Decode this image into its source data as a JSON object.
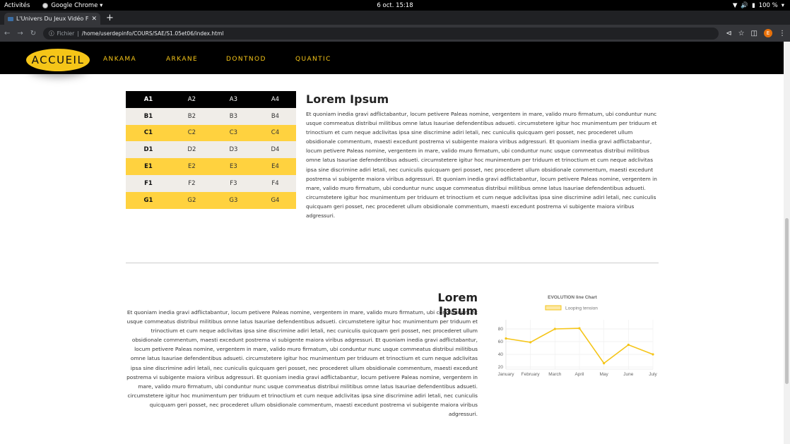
{
  "system_bar": {
    "activities": "Activités",
    "app_name": "Google Chrome ▾",
    "clock": "6 oct.  15:18",
    "battery": "100 %"
  },
  "browser": {
    "tab_title": "L'Univers Du Jeux Vidéo F",
    "address_label": "Fichier",
    "address_path": "/home/userdepinfo/COURS/SAE/S1.05et06/index.html",
    "profile_initial": "E"
  },
  "nav": {
    "home": "ACCUEIL",
    "links": [
      "ANKAMA",
      "ARKANE",
      "DONTNOD",
      "QUANTIC"
    ]
  },
  "table": {
    "rows": [
      [
        "A1",
        "A2",
        "A3",
        "A4"
      ],
      [
        "B1",
        "B2",
        "B3",
        "B4"
      ],
      [
        "C1",
        "C2",
        "C3",
        "C4"
      ],
      [
        "D1",
        "D2",
        "D3",
        "D4"
      ],
      [
        "E1",
        "E2",
        "E3",
        "E4"
      ],
      [
        "F1",
        "F2",
        "F3",
        "F4"
      ],
      [
        "G1",
        "G2",
        "G3",
        "G4"
      ]
    ]
  },
  "section1": {
    "heading": "Lorem Ipsum",
    "body": "Et quoniam inedia gravi adflictabantur, locum petivere Paleas nomine, vergentem in mare, valido muro firmatum, ubi conduntur nunc usque commeatus distribui militibus omne latus Isauriae defendentibus adsueti. circumstetere igitur hoc munimentum per triduum et trinoctium et cum neque adclivitas ipsa sine discrimine adiri letali, nec cuniculis quicquam geri posset, nec procederet ullum obsidionale commentum, maesti excedunt postrema vi subigente maiora viribus adgressuri. Et quoniam inedia gravi adflictabantur, locum petivere Paleas nomine, vergentem in mare, valido muro firmatum, ubi conduntur nunc usque commeatus distribui militibus omne latus Isauriae defendentibus adsueti. circumstetere igitur hoc munimentum per triduum et trinoctium et cum neque adclivitas ipsa sine discrimine adiri letali, nec cuniculis quicquam geri posset, nec procederet ullum obsidionale commentum, maesti excedunt postrema vi subigente maiora viribus adgressuri. Et quoniam inedia gravi adflictabantur, locum petivere Paleas nomine, vergentem in mare, valido muro firmatum, ubi conduntur nunc usque commeatus distribui militibus omne latus Isauriae defendentibus adsueti. circumstetere igitur hoc munimentum per triduum et trinoctium et cum neque adclivitas ipsa sine discrimine adiri letali, nec cuniculis quicquam geri posset, nec procederet ullum obsidionale commentum, maesti excedunt postrema vi subigente maiora viribus adgressuri."
  },
  "section2": {
    "heading": "Lorem Ipsum",
    "body": "Et quoniam inedia gravi adflictabantur, locum petivere Paleas nomine, vergentem in mare, valido muro firmatum, ubi conduntur nunc usque commeatus distribui militibus omne latus Isauriae defendentibus adsueti. circumstetere igitur hoc munimentum per triduum et trinoctium et cum neque adclivitas ipsa sine discrimine adiri letali, nec cuniculis quicquam geri posset, nec procederet ullum obsidionale commentum, maesti excedunt postrema vi subigente maiora viribus adgressuri. Et quoniam inedia gravi adflictabantur, locum petivere Paleas nomine, vergentem in mare, valido muro firmatum, ubi conduntur nunc usque commeatus distribui militibus omne latus Isauriae defendentibus adsueti. circumstetere igitur hoc munimentum per triduum et trinoctium et cum neque adclivitas ipsa sine discrimine adiri letali, nec cuniculis quicquam geri posset, nec procederet ullum obsidionale commentum, maesti excedunt postrema vi subigente maiora viribus adgressuri. Et quoniam inedia gravi adflictabantur, locum petivere Paleas nomine, vergentem in mare, valido muro firmatum, ubi conduntur nunc usque commeatus distribui militibus omne latus Isauriae defendentibus adsueti. circumstetere igitur hoc munimentum per triduum et trinoctium et cum neque adclivitas ipsa sine discrimine adiri letali, nec cuniculis quicquam geri posset, nec procederet ullum obsidionale commentum, maesti excedunt postrema vi subigente maiora viribus adgressuri."
  },
  "colors": {
    "accent": "#f5c518",
    "row_highlight": "#ffd23f",
    "row_alt": "#f0ede8",
    "nav_bg": "#000000"
  },
  "chart_data": {
    "type": "line",
    "title": "EVOLUTION line Chart",
    "categories": [
      "January",
      "February",
      "March",
      "April",
      "May",
      "June",
      "July"
    ],
    "series": [
      {
        "name": "Looping tension",
        "values": [
          65,
          59,
          80,
          81,
          26,
          55,
          40
        ],
        "color": "#f5c518"
      }
    ],
    "yticks": [
      20,
      40,
      60,
      80
    ],
    "ylim": [
      20,
      90
    ],
    "grid": true,
    "legend": "top"
  }
}
